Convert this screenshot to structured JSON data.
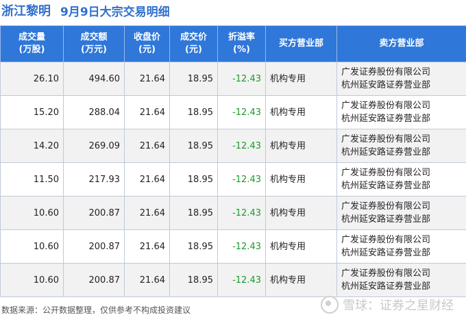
{
  "header": {
    "stock_name": "浙江黎明",
    "subtitle": "9月9日大宗交易明细"
  },
  "table": {
    "columns": [
      {
        "line1": "成交量",
        "line2": "(万股)"
      },
      {
        "line1": "成交额",
        "line2": "(万元)"
      },
      {
        "line1": "收盘价",
        "line2": "(元)"
      },
      {
        "line1": "成交价",
        "line2": "(元)"
      },
      {
        "line1": "折溢率",
        "line2": "(%)"
      },
      {
        "line1": "买方营业部",
        "line2": ""
      },
      {
        "line1": "卖方营业部",
        "line2": ""
      }
    ],
    "rows": [
      {
        "volume": "26.10",
        "amount": "494.60",
        "close": "21.64",
        "price": "18.95",
        "premium": "-12.43",
        "buyer": "机构专用",
        "seller_line1": "广发证券股份有限公司",
        "seller_line2": "杭州延安路证券营业部"
      },
      {
        "volume": "15.20",
        "amount": "288.04",
        "close": "21.64",
        "price": "18.95",
        "premium": "-12.43",
        "buyer": "机构专用",
        "seller_line1": "广发证券股份有限公司",
        "seller_line2": "杭州延安路证券营业部"
      },
      {
        "volume": "14.20",
        "amount": "269.09",
        "close": "21.64",
        "price": "18.95",
        "premium": "-12.43",
        "buyer": "机构专用",
        "seller_line1": "广发证券股份有限公司",
        "seller_line2": "杭州延安路证券营业部"
      },
      {
        "volume": "11.50",
        "amount": "217.93",
        "close": "21.64",
        "price": "18.95",
        "premium": "-12.43",
        "buyer": "机构专用",
        "seller_line1": "广发证券股份有限公司",
        "seller_line2": "杭州延安路证券营业部"
      },
      {
        "volume": "10.60",
        "amount": "200.87",
        "close": "21.64",
        "price": "18.95",
        "premium": "-12.43",
        "buyer": "机构专用",
        "seller_line1": "广发证券股份有限公司",
        "seller_line2": "杭州延安路证券营业部"
      },
      {
        "volume": "10.60",
        "amount": "200.87",
        "close": "21.64",
        "price": "18.95",
        "premium": "-12.43",
        "buyer": "机构专用",
        "seller_line1": "广发证券股份有限公司",
        "seller_line2": "杭州延安路证券营业部"
      },
      {
        "volume": "10.60",
        "amount": "200.87",
        "close": "21.64",
        "price": "18.95",
        "premium": "-12.43",
        "buyer": "机构专用",
        "seller_line1": "广发证券股份有限公司",
        "seller_line2": "杭州延安路证券营业部"
      }
    ]
  },
  "footer": {
    "source_note": "数据来源：公开数据整理，仅供参考不构成投资建议",
    "brand": "雪球：证券之星财经"
  },
  "colors": {
    "header_bg": "#2f77d8",
    "title_blue": "#2f6fcc",
    "negative_green": "#1a9a2a",
    "row_alt": "#f2f2f2"
  }
}
